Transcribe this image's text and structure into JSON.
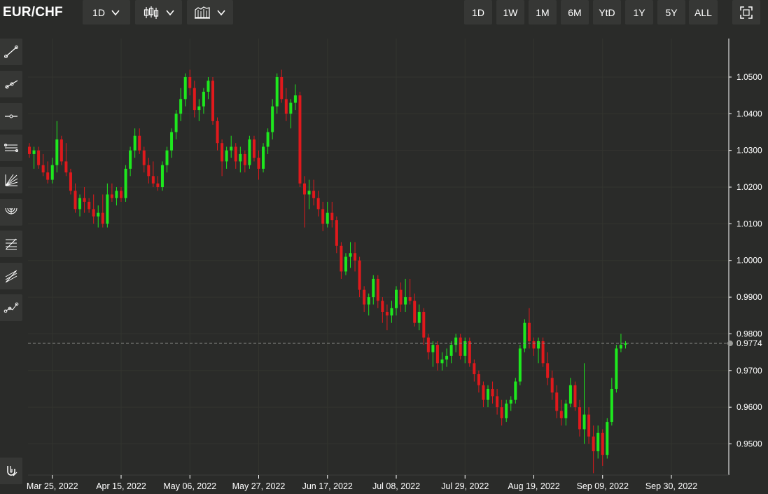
{
  "header": {
    "symbol": "EUR/CHF",
    "interval": "1D",
    "chart_style_icon": "candlestick-icon",
    "indicators_icon": "indicators-icon",
    "ranges": [
      "1D",
      "1W",
      "1M",
      "6M",
      "YtD",
      "1Y",
      "5Y",
      "ALL"
    ],
    "fullscreen_icon": "fullscreen-icon"
  },
  "sidebar": {
    "tools": [
      "trend-line-icon",
      "ray-icon",
      "horizontal-line-icon",
      "parallel-channel-icon",
      "fan-icon",
      "arc-icon",
      "fibonacci-icon",
      "pitchfork-icon",
      "path-icon"
    ],
    "magnet_icon": "magnet-icon"
  },
  "colors": {
    "up": "#1ee81e",
    "down": "#e0191c",
    "grid": "#33342f",
    "background": "#2a2b29"
  },
  "chart_data": {
    "type": "candlestick",
    "title": "",
    "last_price": 0.9774,
    "last_price_label": "0.9774",
    "ylim": [
      0.9415,
      1.0605
    ],
    "y_ticks": [
      0.95,
      0.96,
      0.97,
      0.98,
      0.99,
      1.0,
      1.01,
      1.02,
      1.03,
      1.04,
      1.05
    ],
    "y_tick_labels": [
      "0.9500",
      "0.9600",
      "0.9700",
      "0.9800",
      "0.9900",
      "1.0000",
      "1.0100",
      "1.0200",
      "1.0300",
      "1.0400",
      "1.0500"
    ],
    "x_tick_labels": [
      "Mar 25, 2022",
      "Apr 15, 2022",
      "May 06, 2022",
      "May 27, 2022",
      "Jun 17, 2022",
      "Jul 08, 2022",
      "Jul 29, 2022",
      "Aug 19, 2022",
      "Sep 09, 2022",
      "Sep 30, 2022"
    ],
    "x_tick_index": [
      5,
      20,
      35,
      50,
      65,
      80,
      95,
      110,
      125,
      140
    ],
    "candles": [
      [
        1.031,
        1.032,
        1.028,
        1.029
      ],
      [
        1.029,
        1.031,
        1.025,
        1.03
      ],
      [
        1.03,
        1.031,
        1.025,
        1.026
      ],
      [
        1.026,
        1.029,
        1.023,
        1.024
      ],
      [
        1.024,
        1.027,
        1.021,
        1.022
      ],
      [
        1.022,
        1.028,
        1.021,
        1.026
      ],
      [
        1.026,
        1.038,
        1.024,
        1.033
      ],
      [
        1.033,
        1.034,
        1.026,
        1.027
      ],
      [
        1.027,
        1.032,
        1.023,
        1.024
      ],
      [
        1.024,
        1.025,
        1.018,
        1.019
      ],
      [
        1.019,
        1.021,
        1.013,
        1.014
      ],
      [
        1.014,
        1.018,
        1.012,
        1.017
      ],
      [
        1.017,
        1.02,
        1.013,
        1.016
      ],
      [
        1.016,
        1.017,
        1.013,
        1.014
      ],
      [
        1.014,
        1.018,
        1.01,
        1.012
      ],
      [
        1.012,
        1.015,
        1.009,
        1.013
      ],
      [
        1.013,
        1.018,
        1.009,
        1.01
      ],
      [
        1.01,
        1.021,
        1.009,
        1.018
      ],
      [
        1.018,
        1.021,
        1.016,
        1.017
      ],
      [
        1.017,
        1.02,
        1.015,
        1.019
      ],
      [
        1.019,
        1.02,
        1.016,
        1.017
      ],
      [
        1.017,
        1.026,
        1.016,
        1.025
      ],
      [
        1.025,
        1.031,
        1.023,
        1.03
      ],
      [
        1.03,
        1.036,
        1.028,
        1.034
      ],
      [
        1.034,
        1.036,
        1.029,
        1.03
      ],
      [
        1.03,
        1.031,
        1.024,
        1.026
      ],
      [
        1.026,
        1.028,
        1.021,
        1.023
      ],
      [
        1.023,
        1.027,
        1.02,
        1.021
      ],
      [
        1.021,
        1.023,
        1.019,
        1.02
      ],
      [
        1.02,
        1.027,
        1.019,
        1.026
      ],
      [
        1.026,
        1.031,
        1.024,
        1.03
      ],
      [
        1.03,
        1.036,
        1.028,
        1.035
      ],
      [
        1.035,
        1.041,
        1.033,
        1.04
      ],
      [
        1.04,
        1.047,
        1.038,
        1.044
      ],
      [
        1.044,
        1.051,
        1.042,
        1.05
      ],
      [
        1.05,
        1.052,
        1.045,
        1.047
      ],
      [
        1.047,
        1.049,
        1.039,
        1.041
      ],
      [
        1.041,
        1.044,
        1.038,
        1.042
      ],
      [
        1.042,
        1.047,
        1.04,
        1.046
      ],
      [
        1.046,
        1.05,
        1.044,
        1.049
      ],
      [
        1.049,
        1.05,
        1.037,
        1.038
      ],
      [
        1.038,
        1.039,
        1.03,
        1.032
      ],
      [
        1.032,
        1.033,
        1.023,
        1.027
      ],
      [
        1.027,
        1.031,
        1.025,
        1.03
      ],
      [
        1.03,
        1.034,
        1.028,
        1.031
      ],
      [
        1.031,
        1.032,
        1.025,
        1.027
      ],
      [
        1.027,
        1.031,
        1.024,
        1.029
      ],
      [
        1.029,
        1.03,
        1.024,
        1.026
      ],
      [
        1.026,
        1.034,
        1.025,
        1.033
      ],
      [
        1.033,
        1.034,
        1.027,
        1.028
      ],
      [
        1.028,
        1.03,
        1.022,
        1.025
      ],
      [
        1.025,
        1.032,
        1.024,
        1.031
      ],
      [
        1.031,
        1.036,
        1.029,
        1.035
      ],
      [
        1.035,
        1.044,
        1.033,
        1.042
      ],
      [
        1.042,
        1.051,
        1.04,
        1.05
      ],
      [
        1.05,
        1.052,
        1.043,
        1.044
      ],
      [
        1.044,
        1.047,
        1.038,
        1.04
      ],
      [
        1.04,
        1.044,
        1.036,
        1.043
      ],
      [
        1.043,
        1.048,
        1.041,
        1.045
      ],
      [
        1.045,
        1.046,
        1.02,
        1.021
      ],
      [
        1.021,
        1.023,
        1.009,
        1.018
      ],
      [
        1.018,
        1.022,
        1.014,
        1.019
      ],
      [
        1.019,
        1.022,
        1.015,
        1.017
      ],
      [
        1.017,
        1.019,
        1.012,
        1.014
      ],
      [
        1.014,
        1.016,
        1.008,
        1.01
      ],
      [
        1.01,
        1.016,
        1.009,
        1.013
      ],
      [
        1.013,
        1.016,
        1.009,
        1.011
      ],
      [
        1.011,
        1.012,
        1.002,
        1.004
      ],
      [
        1.004,
        1.005,
        0.995,
        0.997
      ],
      [
        0.997,
        1.002,
        0.996,
        1.001
      ],
      [
        1.001,
        1.005,
        0.998,
        1.002
      ],
      [
        1.002,
        1.005,
        0.997,
        1.0
      ],
      [
        1.0,
        1.001,
        0.99,
        0.992
      ],
      [
        0.992,
        0.993,
        0.986,
        0.988
      ],
      [
        0.988,
        0.991,
        0.985,
        0.99
      ],
      [
        0.99,
        0.996,
        0.988,
        0.995
      ],
      [
        0.995,
        0.996,
        0.987,
        0.989
      ],
      [
        0.989,
        0.99,
        0.983,
        0.986
      ],
      [
        0.986,
        0.988,
        0.981,
        0.985
      ],
      [
        0.985,
        0.989,
        0.983,
        0.987
      ],
      [
        0.987,
        0.993,
        0.985,
        0.992
      ],
      [
        0.992,
        0.994,
        0.986,
        0.988
      ],
      [
        0.988,
        0.995,
        0.986,
        0.99
      ],
      [
        0.99,
        0.995,
        0.988,
        0.989
      ],
      [
        0.989,
        0.991,
        0.982,
        0.983
      ],
      [
        0.983,
        0.988,
        0.981,
        0.986
      ],
      [
        0.986,
        0.987,
        0.977,
        0.979
      ],
      [
        0.979,
        0.98,
        0.973,
        0.975
      ],
      [
        0.975,
        0.978,
        0.971,
        0.977
      ],
      [
        0.977,
        0.978,
        0.97,
        0.972
      ],
      [
        0.972,
        0.975,
        0.97,
        0.973
      ],
      [
        0.973,
        0.976,
        0.971,
        0.974
      ],
      [
        0.974,
        0.978,
        0.972,
        0.977
      ],
      [
        0.977,
        0.98,
        0.975,
        0.979
      ],
      [
        0.979,
        0.98,
        0.973,
        0.974
      ],
      [
        0.974,
        0.979,
        0.972,
        0.978
      ],
      [
        0.978,
        0.979,
        0.971,
        0.972
      ],
      [
        0.972,
        0.973,
        0.967,
        0.969
      ],
      [
        0.969,
        0.97,
        0.964,
        0.966
      ],
      [
        0.966,
        0.967,
        0.96,
        0.962
      ],
      [
        0.962,
        0.966,
        0.96,
        0.965
      ],
      [
        0.965,
        0.967,
        0.961,
        0.963
      ],
      [
        0.963,
        0.965,
        0.958,
        0.96
      ],
      [
        0.96,
        0.962,
        0.955,
        0.957
      ],
      [
        0.957,
        0.962,
        0.956,
        0.961
      ],
      [
        0.961,
        0.963,
        0.959,
        0.962
      ],
      [
        0.962,
        0.968,
        0.961,
        0.967
      ],
      [
        0.967,
        0.977,
        0.966,
        0.976
      ],
      [
        0.976,
        0.984,
        0.975,
        0.983
      ],
      [
        0.983,
        0.987,
        0.976,
        0.978
      ],
      [
        0.978,
        0.979,
        0.974,
        0.976
      ],
      [
        0.976,
        0.979,
        0.972,
        0.978
      ],
      [
        0.978,
        0.979,
        0.971,
        0.972
      ],
      [
        0.972,
        0.975,
        0.966,
        0.968
      ],
      [
        0.968,
        0.97,
        0.962,
        0.964
      ],
      [
        0.964,
        0.966,
        0.957,
        0.959
      ],
      [
        0.959,
        0.962,
        0.955,
        0.957
      ],
      [
        0.957,
        0.962,
        0.955,
        0.961
      ],
      [
        0.961,
        0.968,
        0.96,
        0.966
      ],
      [
        0.966,
        0.967,
        0.959,
        0.96
      ],
      [
        0.96,
        0.962,
        0.952,
        0.954
      ],
      [
        0.954,
        0.972,
        0.95,
        0.958
      ],
      [
        0.958,
        0.96,
        0.95,
        0.952
      ],
      [
        0.952,
        0.955,
        0.942,
        0.948
      ],
      [
        0.948,
        0.955,
        0.946,
        0.953
      ],
      [
        0.953,
        0.954,
        0.944,
        0.947
      ],
      [
        0.947,
        0.957,
        0.946,
        0.956
      ],
      [
        0.956,
        0.968,
        0.955,
        0.965
      ],
      [
        0.965,
        0.977,
        0.964,
        0.976
      ],
      [
        0.976,
        0.98,
        0.975,
        0.977
      ],
      [
        0.977,
        0.978,
        0.976,
        0.9774
      ]
    ]
  }
}
